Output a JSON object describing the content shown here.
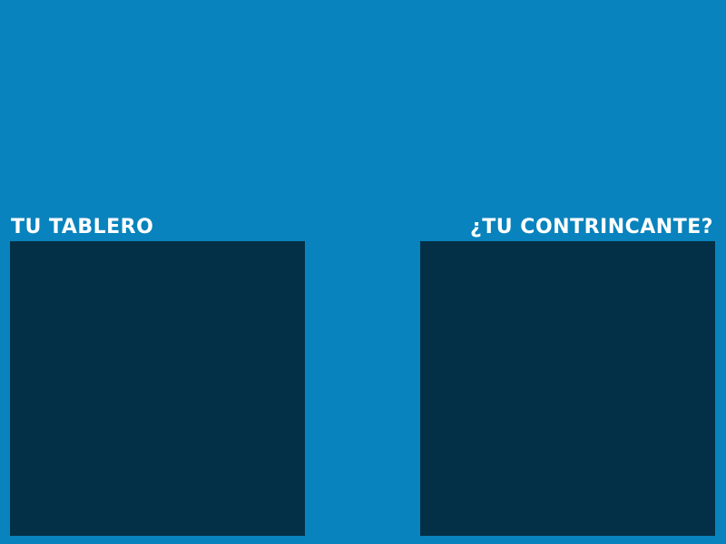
{
  "colors": {
    "background": "#0983bd",
    "board": "#043047",
    "label_text": "#ffffff"
  },
  "player_board": {
    "label": "TU TABLERO"
  },
  "opponent_board": {
    "label": "¿TU CONTRINCANTE?"
  }
}
